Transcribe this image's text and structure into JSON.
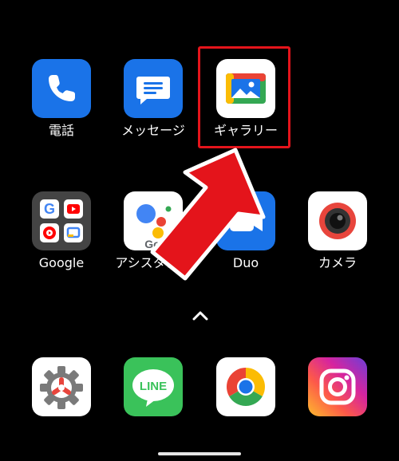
{
  "row1": {
    "phone": {
      "label": "電話",
      "icon": "phone-icon"
    },
    "messages": {
      "label": "メッセージ",
      "icon": "message-bubble-icon"
    },
    "gallery": {
      "label": "ギャラリー",
      "icon": "gallery-photo-icon"
    }
  },
  "row2": {
    "google": {
      "label": "Google",
      "icon": "google-folder-icon"
    },
    "assistant": {
      "label": "アシスタント",
      "icon": "assistant-icon"
    },
    "duo": {
      "label": "Duo",
      "icon": "video-camera-icon"
    },
    "camera": {
      "label": "カメラ",
      "icon": "camera-lens-icon"
    }
  },
  "dock": [
    {
      "name": "settings",
      "icon": "settings-gear-icon"
    },
    {
      "name": "line",
      "icon": "line-icon",
      "text": "LINE"
    },
    {
      "name": "chrome",
      "icon": "chrome-icon"
    },
    {
      "name": "instagram",
      "icon": "instagram-icon"
    }
  ],
  "assistant_partial_text": "Go",
  "colors": {
    "background": "#000000",
    "highlight_red": "#e4141b",
    "phone_blue": "#1a73e8",
    "duo_blue": "#1a73e8",
    "line_green": "#3ac25a"
  }
}
